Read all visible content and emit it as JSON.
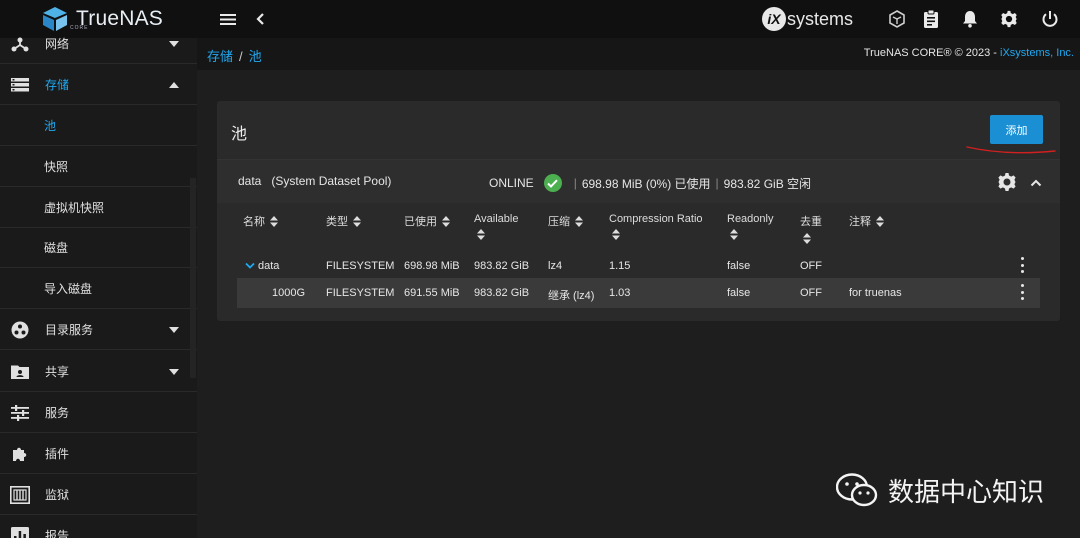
{
  "brand": {
    "name": "TrueNAS",
    "sub": "CORE"
  },
  "vendor": {
    "badge": "iX",
    "name": "systems"
  },
  "colors": {
    "accent": "#1fa9f1",
    "button": "#1a8fd4",
    "ok": "#4caf50",
    "annotation": "#d21f1f"
  },
  "topbar": {
    "icons": [
      "menu-icon",
      "chevron-left-icon",
      "truecommand-icon",
      "clipboard-icon",
      "bell-icon",
      "gear-icon",
      "power-icon"
    ]
  },
  "sidebar": {
    "items": [
      {
        "label": "网络",
        "icon": "network-icon",
        "expand": "down"
      },
      {
        "label": "存储",
        "icon": "storage-icon",
        "expand": "up",
        "active": true
      },
      {
        "label": "池",
        "sub": true,
        "active": true
      },
      {
        "label": "快照",
        "sub": true
      },
      {
        "label": "虚拟机快照",
        "sub": true
      },
      {
        "label": "磁盘",
        "sub": true
      },
      {
        "label": "导入磁盘",
        "sub": true
      },
      {
        "label": "目录服务",
        "icon": "directory-services-icon",
        "expand": "down"
      },
      {
        "label": "共享",
        "icon": "shares-icon",
        "expand": "down"
      },
      {
        "label": "服务",
        "icon": "services-icon"
      },
      {
        "label": "插件",
        "icon": "plugins-icon"
      },
      {
        "label": "监狱",
        "icon": "jails-icon"
      },
      {
        "label": "报告",
        "icon": "reporting-icon"
      }
    ]
  },
  "breadcrumb": {
    "root": "存储",
    "sep": "/",
    "current": "池"
  },
  "copyright": {
    "text": "TrueNAS CORE® © 2023 - ",
    "link": "iXsystems, Inc."
  },
  "card": {
    "title": "池",
    "add_label": "添加"
  },
  "pool": {
    "name": "data",
    "tag": "(System Dataset Pool)",
    "status": "ONLINE",
    "used": "698.98 MiB (0%) 已使用",
    "free": "983.82 GiB 空闲"
  },
  "table": {
    "columns": [
      "名称",
      "类型",
      "已使用",
      "Available",
      "压缩",
      "Compression Ratio",
      "Readonly",
      "去重",
      "注释"
    ],
    "rows": [
      {
        "name": "data",
        "type": "FILESYSTEM",
        "used": "698.98 MiB",
        "available": "983.82 GiB",
        "compression": "lz4",
        "ratio": "1.15",
        "readonly": "false",
        "dedup": "OFF",
        "comment": ""
      },
      {
        "name": "1000G",
        "type": "FILESYSTEM",
        "used": "691.55 MiB",
        "available": "983.82 GiB",
        "compression": "继承 (lz4)",
        "ratio": "1.03",
        "readonly": "false",
        "dedup": "OFF",
        "comment": "for truenas"
      }
    ]
  },
  "watermark": {
    "text": "数据中心知识",
    "icon": "wechat-icon"
  }
}
